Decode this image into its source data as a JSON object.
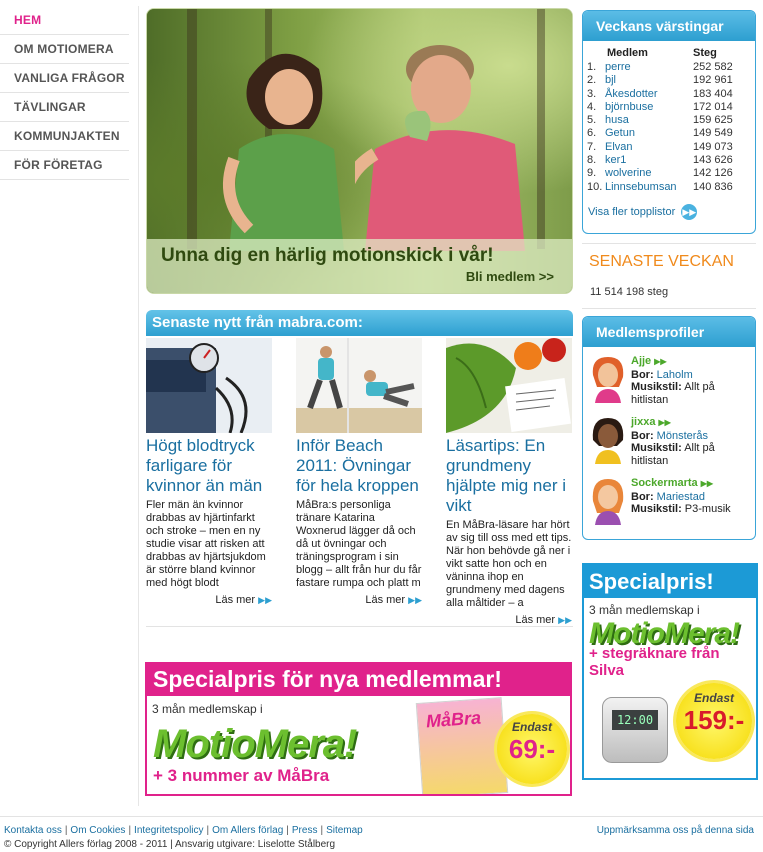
{
  "nav": {
    "items": [
      {
        "label": "HEM",
        "active": true
      },
      {
        "label": "OM MOTIOMERA"
      },
      {
        "label": "VANLIGA FRÅGOR"
      },
      {
        "label": "TÄVLINGAR"
      },
      {
        "label": "KOMMUNJAKTEN"
      },
      {
        "label": "FÖR FÖRETAG"
      }
    ]
  },
  "hero": {
    "caption": "Unna dig en härlig motionskick i vår!",
    "cta": "Bli medlem >>"
  },
  "news": {
    "header": "Senaste nytt från mabra.com:",
    "articles": [
      {
        "title": "Högt blodtryck farligare för kvinnor än män",
        "text": "Fler män än kvinnor drabbas av hjärtinfarkt och stroke – men en ny studie visar att risken att drabbas av hjärtsjukdom är större bland kvinnor med högt blodt",
        "more": "Läs mer"
      },
      {
        "title": "Inför Beach 2011: Övningar för hela kroppen",
        "text": "MåBra:s personliga tränare Katarina Woxnerud lägger då och då ut övningar och träningsprogram i sin blogg – allt från hur du får fastare rumpa och platt m",
        "more": "Läs mer"
      },
      {
        "title": "Läsartips: En grundmeny hjälpte mig ner i vikt",
        "text": "En MåBra-läsare har hört av sig till oss med ett tips. När hon behövde gå ner i vikt satte hon och en väninna ihop en grundmeny med dagens alla måltider – a",
        "more": "Läs mer"
      }
    ]
  },
  "banner": {
    "headline": "Specialpris för nya medlemmar!",
    "sub": "3 mån medlemskap i",
    "logo": "MotioMera!",
    "plus": "+ 3 nummer av MåBra",
    "mag_logo": "MåBra",
    "burst_small": "Endast",
    "burst_price": "69:-"
  },
  "toplist": {
    "title": "Veckans värstingar",
    "col_member": "Medlem",
    "col_steps": "Steg",
    "rows": [
      {
        "rank": "1.",
        "member": "perre",
        "steps": "252 582"
      },
      {
        "rank": "2.",
        "member": "bjl",
        "steps": "192 961"
      },
      {
        "rank": "3.",
        "member": "Åkesdotter",
        "steps": "183 404"
      },
      {
        "rank": "4.",
        "member": "björnbuse",
        "steps": "172 014"
      },
      {
        "rank": "5.",
        "member": "husa",
        "steps": "159 625"
      },
      {
        "rank": "6.",
        "member": "Getun",
        "steps": "149 549"
      },
      {
        "rank": "7.",
        "member": "Elvan",
        "steps": "149 073"
      },
      {
        "rank": "8.",
        "member": "ker1",
        "steps": "143 626"
      },
      {
        "rank": "9.",
        "member": "wolverine",
        "steps": "142 126"
      },
      {
        "rank": "10.",
        "member": "Linnsebumsan",
        "steps": "140 836"
      }
    ],
    "more": "Visa fler topplistor"
  },
  "week": {
    "title": "SENASTE VECKAN",
    "value": "11 514 198 steg"
  },
  "profiles": {
    "title": "Medlemsprofiler",
    "label_lives": "Bor:",
    "label_music": "Musikstil:",
    "items": [
      {
        "name": "Ajje",
        "city": "Laholm",
        "music": "Allt på hitlistan"
      },
      {
        "name": "jixxa",
        "city": "Mönsterås",
        "music": "Allt på hitlistan"
      },
      {
        "name": "Sockermarta",
        "city": "Mariestad",
        "music": "P3-musik"
      }
    ]
  },
  "ad_right": {
    "headline": "Specialpris!",
    "sub": "3 mån medlemskap i",
    "logo": "MotioMera!",
    "plus": "+ stegräknare från Silva",
    "pedo_screen": "12:00",
    "burst_small": "Endast",
    "burst_price": "159:-"
  },
  "footer": {
    "links": [
      "Kontakta oss",
      "Om Cookies",
      "Integritetspolicy",
      "Om Allers förlag",
      "Press",
      "Sitemap"
    ],
    "right_link": "Uppmärksamma oss på denna sida",
    "copyright": "© Copyright Allers förlag 2008 - 2011 | Ansvarig utgivare: Liselotte Stålberg"
  }
}
